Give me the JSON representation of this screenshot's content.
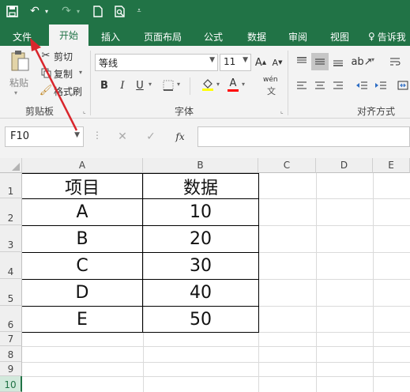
{
  "quick_access": {
    "save": "save-icon",
    "undo": "undo-icon",
    "redo": "redo-icon",
    "new": "new-file-icon",
    "preview": "print-preview-icon",
    "customize": "customize-icon"
  },
  "tabs": [
    {
      "label": "文件"
    },
    {
      "label": "开始"
    },
    {
      "label": "插入"
    },
    {
      "label": "页面布局"
    },
    {
      "label": "公式"
    },
    {
      "label": "数据"
    },
    {
      "label": "审阅"
    },
    {
      "label": "视图"
    },
    {
      "label": "告诉我"
    }
  ],
  "clipboard": {
    "paste": "粘贴",
    "cut": "剪切",
    "copy": "复制",
    "format_painter": "格式刷",
    "group": "剪贴板"
  },
  "font": {
    "name": "等线",
    "size": "11",
    "bold": "B",
    "italic": "I",
    "underline": "U",
    "group": "字体",
    "phonetic": "wén"
  },
  "alignment": {
    "group": "对齐方式"
  },
  "name_box": "F10",
  "columns": [
    "A",
    "B",
    "C",
    "D",
    "E"
  ],
  "rows": [
    "1",
    "2",
    "3",
    "4",
    "5",
    "6",
    "7",
    "8",
    "9",
    "10"
  ],
  "table": {
    "header": [
      "项目",
      "数据"
    ],
    "rows": [
      [
        "A",
        "10"
      ],
      [
        "B",
        "20"
      ],
      [
        "C",
        "30"
      ],
      [
        "D",
        "40"
      ],
      [
        "E",
        "50"
      ]
    ]
  },
  "colors": {
    "brand": "#217346",
    "annotation_arrow": "#d9262c"
  }
}
